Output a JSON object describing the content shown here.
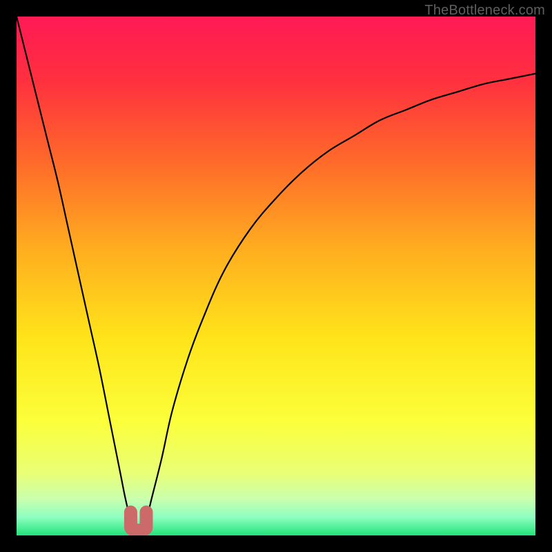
{
  "watermark": "TheBottleneck.com",
  "colors": {
    "frame": "#000000",
    "gradient_stops": [
      {
        "offset": 0.0,
        "color": "#ff1a55"
      },
      {
        "offset": 0.12,
        "color": "#ff2f3f"
      },
      {
        "offset": 0.28,
        "color": "#ff6a2a"
      },
      {
        "offset": 0.45,
        "color": "#ffae1f"
      },
      {
        "offset": 0.62,
        "color": "#ffe41a"
      },
      {
        "offset": 0.78,
        "color": "#fbff3a"
      },
      {
        "offset": 0.88,
        "color": "#e9ff76"
      },
      {
        "offset": 0.93,
        "color": "#c9ffae"
      },
      {
        "offset": 0.965,
        "color": "#8dffc0"
      },
      {
        "offset": 1.0,
        "color": "#22e37a"
      }
    ],
    "curve": "#000000",
    "marker_fill": "#cc6a6a",
    "marker_stroke": "#cc6a6a"
  },
  "chart_data": {
    "type": "line",
    "title": "",
    "xlabel": "",
    "ylabel": "",
    "xlim": [
      0,
      100
    ],
    "ylim": [
      0,
      100
    ],
    "grid": false,
    "series": [
      {
        "name": "bottleneck-curve",
        "x": [
          0,
          2,
          4,
          6,
          8,
          10,
          12,
          14,
          16,
          18,
          20,
          21,
          22,
          23,
          24,
          25,
          26,
          28,
          30,
          33,
          36,
          40,
          45,
          50,
          55,
          60,
          65,
          70,
          75,
          80,
          85,
          90,
          95,
          100
        ],
        "y": [
          100,
          92,
          84,
          76,
          68,
          59,
          50,
          41,
          32,
          22,
          12,
          7,
          3,
          1,
          1,
          3,
          7,
          15,
          24,
          34,
          42,
          51,
          59,
          65,
          70,
          74,
          77,
          80,
          82,
          84,
          85.5,
          87,
          88,
          89
        ]
      }
    ],
    "marker": {
      "name": "optimal-range",
      "x_range": [
        22,
        25
      ],
      "y_at_bottom": 1,
      "shape": "U"
    },
    "legend": false
  }
}
